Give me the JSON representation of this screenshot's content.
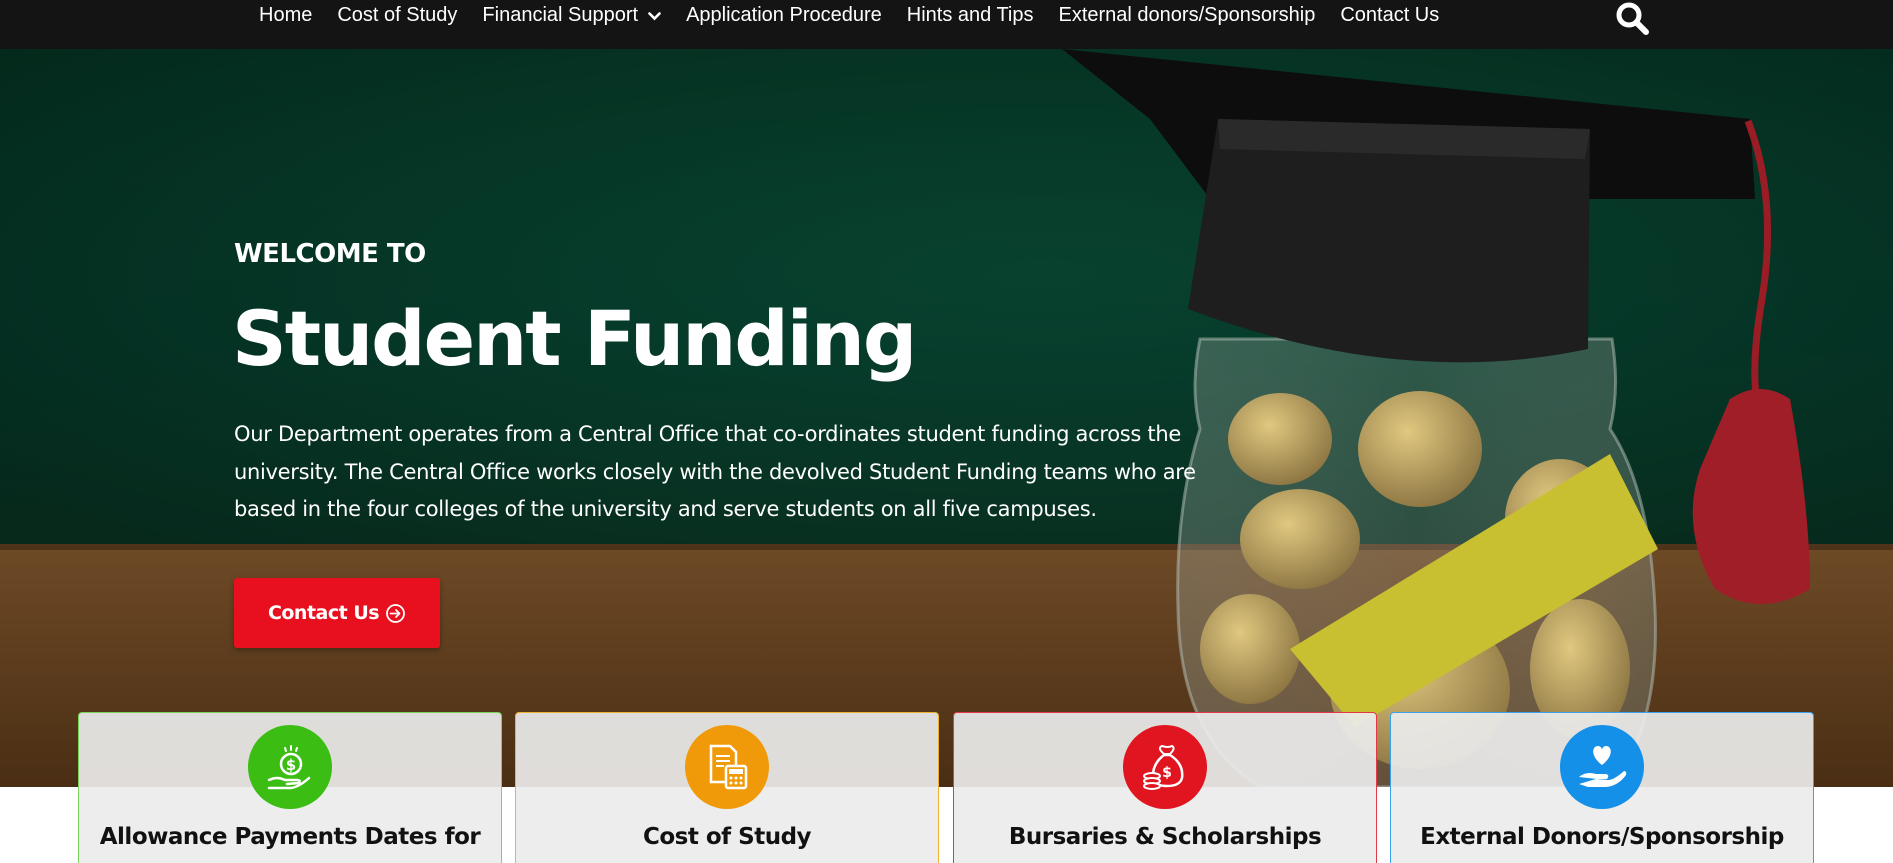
{
  "nav": {
    "items": [
      {
        "label": "Home"
      },
      {
        "label": "Cost of Study"
      },
      {
        "label": "Financial Support"
      },
      {
        "label": "Application Procedure"
      },
      {
        "label": "Hints and Tips"
      },
      {
        "label": "External donors/Sponsorship"
      },
      {
        "label": "Contact Us"
      }
    ],
    "dropdown_icon": "chevron-down-icon",
    "search_icon": "search-icon"
  },
  "hero": {
    "eyebrow": "WELCOME TO",
    "title": "Student Funding",
    "description": "Our Department operates from a Central Office that co-ordinates student funding across the university.  The Central Office works closely with the devolved Student Funding teams who are based in the four colleges of the university and serve students on all five campuses.",
    "cta_label": "Contact Us",
    "cta_icon": "arrow-circle-right-icon"
  },
  "cards": [
    {
      "title": "Allowance Payments Dates for",
      "icon": "hand-money-icon",
      "color": "#3bbd13",
      "border": "#7bd35a"
    },
    {
      "title": "Cost of Study",
      "icon": "calculator-document-icon",
      "color": "#f09a0a",
      "border": "#f0b030"
    },
    {
      "title": "Bursaries & Scholarships",
      "icon": "money-bag-icon",
      "color": "#e01520",
      "border": "#e23a44"
    },
    {
      "title": "External Donors/Sponsorship",
      "icon": "hand-heart-icon",
      "color": "#1590e8",
      "border": "#3aa2ec"
    }
  ],
  "colors": {
    "nav_bg": "#141414",
    "hero_bg": "#073a28",
    "cta_bg": "#e8101e"
  }
}
